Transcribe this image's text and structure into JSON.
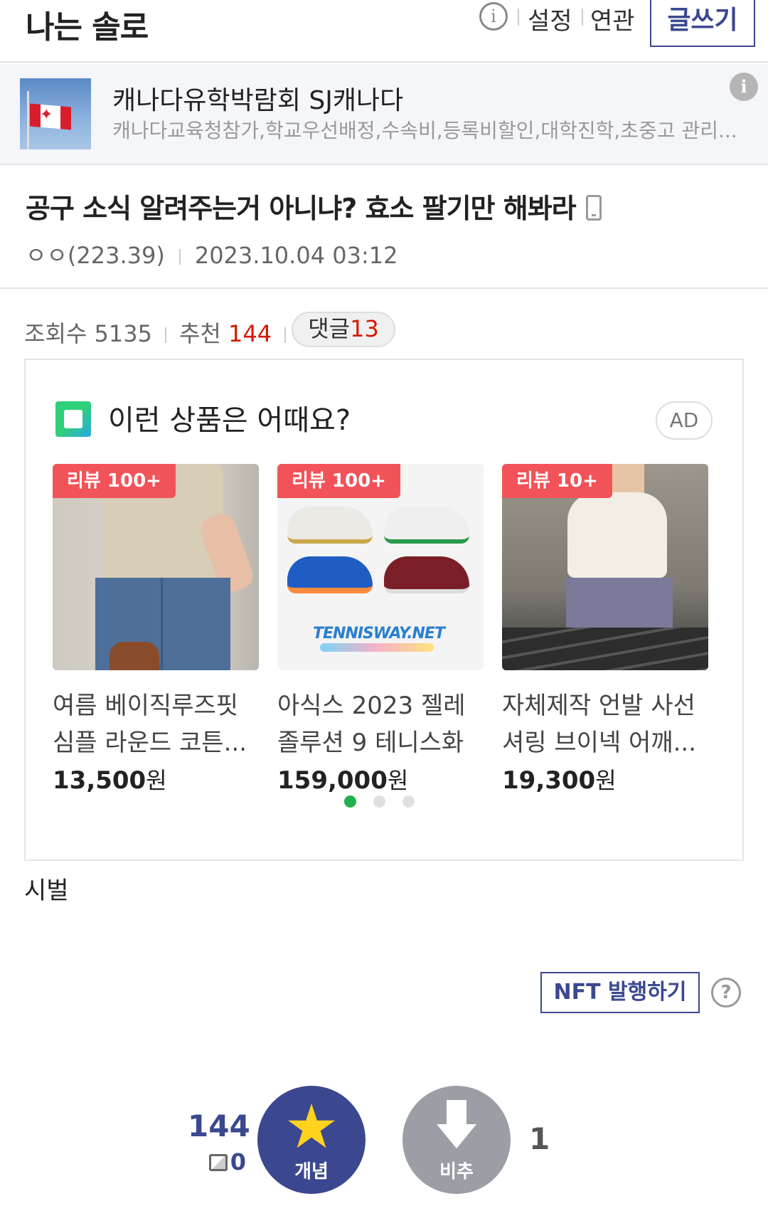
{
  "header": {
    "gallery_title": "나는 솔로",
    "info_label": "i",
    "links": [
      "설정",
      "연관"
    ],
    "write_label": "글쓰기"
  },
  "sponsor": {
    "title": "캐나다유학박람회 SJ캐나다",
    "description": "캐나다교육청참가,학교우선배정,수속비,등록비할인,대학진학,초중고 관리...",
    "info_label": "i"
  },
  "post": {
    "title": "공구 소식 알려주는거 아니냐? 효소 팔기만 해봐라",
    "author": "ㅇㅇ(223.39)",
    "date": "2023.10.04 03:12",
    "views_label": "조회수",
    "views": "5135",
    "recommend_label": "추천",
    "recommend": "144",
    "comments_label": "댓글",
    "comments": "13",
    "body": "시벌"
  },
  "ad": {
    "heading": "이런 상품은 어때요?",
    "badge": "AD",
    "won": "원",
    "products": [
      {
        "badge": "리뷰 100+",
        "name_line1": "여름 베이직루즈핏",
        "name_line2": "심플 라운드 코튼...",
        "price": "13,500"
      },
      {
        "badge": "리뷰 100+",
        "name_line1": "아식스 2023 젤레",
        "name_line2": "졸루션 9 테니스화",
        "price": "159,000",
        "logo_text": "TENNISWAY.NET"
      },
      {
        "badge": "리뷰 10+",
        "name_line1": "자체제작 언발 사선",
        "name_line2": "셔링 브이넥 어깨...",
        "price": "19,300"
      }
    ],
    "page_count": 3,
    "active_page": 1
  },
  "nft": {
    "label": "NFT 발행하기",
    "help": "?"
  },
  "vote": {
    "up_count": "144",
    "fix_count": "0",
    "up_label": "개념",
    "down_label": "비추",
    "down_count": "1"
  },
  "colors": {
    "brand": "#3b4890",
    "accent_red": "#d31900",
    "review_badge": "#f25358",
    "active_dot": "#21b04b"
  }
}
